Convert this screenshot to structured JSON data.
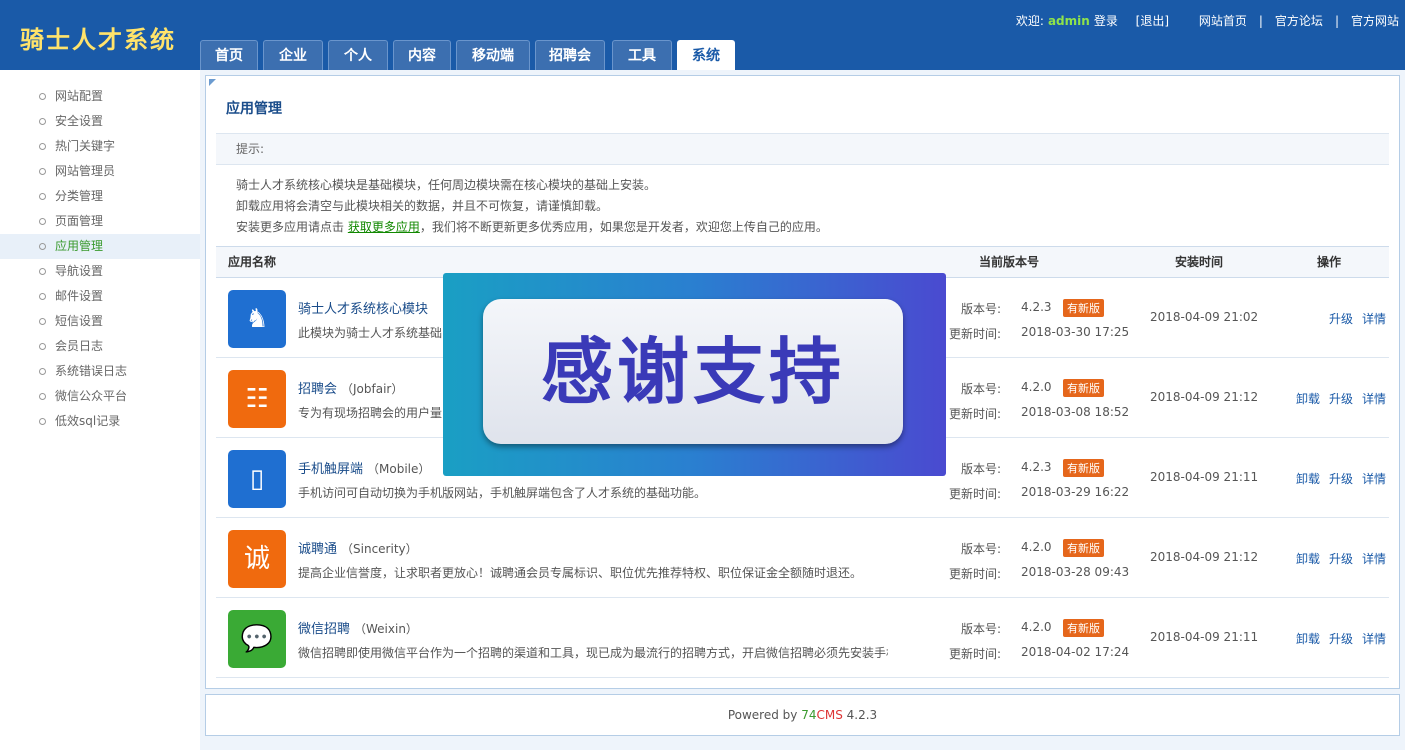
{
  "header": {
    "logo": "骑士人才系统",
    "welcome": "欢迎:",
    "username": "admin",
    "login": "登录",
    "logout": "[退出]",
    "links": [
      "网站首页",
      "官方论坛",
      "官方网站"
    ],
    "separator": "|"
  },
  "tabs": [
    {
      "label": "首页"
    },
    {
      "label": "企业"
    },
    {
      "label": "个人"
    },
    {
      "label": "内容"
    },
    {
      "label": "移动端"
    },
    {
      "label": "招聘会"
    },
    {
      "label": "工具"
    },
    {
      "label": "系统",
      "active": true
    }
  ],
  "sidebar": {
    "items": [
      {
        "label": "网站配置"
      },
      {
        "label": "安全设置"
      },
      {
        "label": "热门关键字"
      },
      {
        "label": "网站管理员"
      },
      {
        "label": "分类管理"
      },
      {
        "label": "页面管理"
      },
      {
        "label": "应用管理",
        "active": true
      },
      {
        "label": "导航设置"
      },
      {
        "label": "邮件设置"
      },
      {
        "label": "短信设置"
      },
      {
        "label": "会员日志"
      },
      {
        "label": "系统错误日志"
      },
      {
        "label": "微信公众平台"
      },
      {
        "label": "低效sql记录"
      }
    ]
  },
  "main": {
    "title": "应用管理",
    "hint_label": "提示:",
    "hint1": "骑士人才系统核心模块是基础模块，任何周边模块需在核心模块的基础上安装。",
    "hint2": "卸载应用将会清空与此模块相关的数据，并且不可恢复，请谨慎卸载。",
    "hint3_pre": "安装更多应用请点击 ",
    "hint3_link": "获取更多应用",
    "hint3_post": "，我们将不断更新更多优秀应用，如果您是开发者，欢迎您上传自己的应用。",
    "columns": {
      "name": "应用名称",
      "version": "当前版本号",
      "install_time": "安装时间",
      "actions": "操作"
    },
    "labels": {
      "version": "版本号:",
      "update_time": "更新时间:",
      "badge": "有新版",
      "uninstall": "卸载",
      "upgrade": "升级",
      "details": "详情"
    },
    "apps": [
      {
        "name": "骑士人才系统核心模块",
        "en": "",
        "desc": "此模块为骑士人才系统基础",
        "version": "4.2.3",
        "update_time": "2018-03-30 17:25",
        "install_time": "2018-04-09 21:02",
        "icon": "knight-icon",
        "color": "#1f6fd1",
        "glyph": "♞"
      },
      {
        "name": "招聘会",
        "en": "（Jobfair）",
        "desc": "专为有现场招聘会的用户量",
        "version": "4.2.0",
        "update_time": "2018-03-08 18:52",
        "install_time": "2018-04-09 21:12",
        "icon": "jobfair-icon",
        "color": "#f06a0e",
        "glyph": "☷"
      },
      {
        "name": "手机触屏端",
        "en": "（Mobile）",
        "desc": "手机访问可自动切换为手机版网站，手机触屏端包含了人才系统的基础功能。",
        "version": "4.2.3",
        "update_time": "2018-03-29 16:22",
        "install_time": "2018-04-09 21:11",
        "icon": "mobile-icon",
        "color": "#1f6fd1",
        "glyph": "▯"
      },
      {
        "name": "诚聘通",
        "en": "（Sincerity）",
        "desc": "提高企业信誉度，让求职者更放心！诚聘通会员专属标识、职位优先推荐特权、职位保证金全额随时退还。",
        "version": "4.2.0",
        "update_time": "2018-03-28 09:43",
        "install_time": "2018-04-09 21:12",
        "icon": "sincerity-icon",
        "color": "#f06a0e",
        "glyph": "诚"
      },
      {
        "name": "微信招聘",
        "en": "（Weixin）",
        "desc": "微信招聘即使用微信平台作为一个招聘的渠道和工具，现已成为最流行的招聘方式，开启微信招聘必须先安装手机",
        "version": "4.2.0",
        "update_time": "2018-04-02 17:24",
        "install_time": "2018-04-09 21:11",
        "icon": "wechat-icon",
        "color": "#3aaa35",
        "glyph": "💬"
      }
    ]
  },
  "overlay": {
    "text": "感谢支持"
  },
  "footer": {
    "powered": "Powered by ",
    "brand1": "74",
    "brand2": "CMS",
    "version": " 4.2.3"
  }
}
